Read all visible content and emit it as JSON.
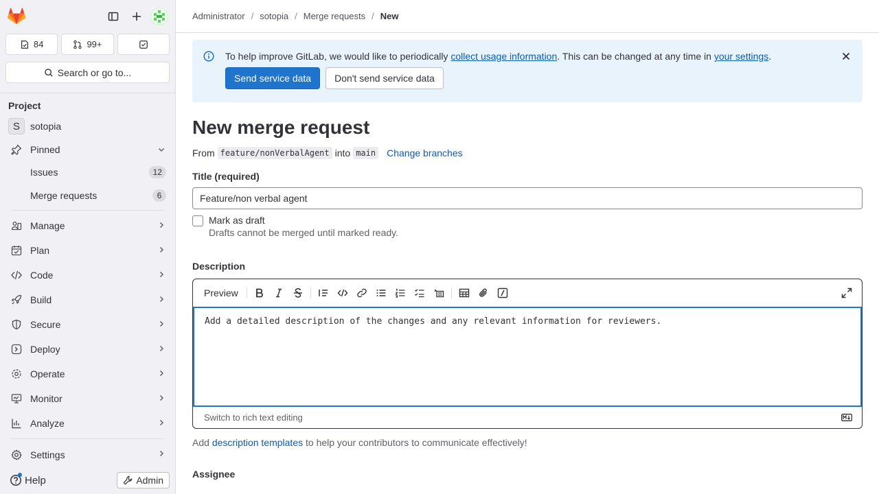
{
  "sidebar": {
    "counters": {
      "issues": "84",
      "merge_requests": "99+"
    },
    "search_label": "Search or go to...",
    "section_title": "Project",
    "project": {
      "letter": "S",
      "name": "sotopia"
    },
    "pinned": {
      "label": "Pinned",
      "items": [
        {
          "label": "Issues",
          "count": "12"
        },
        {
          "label": "Merge requests",
          "count": "6"
        }
      ]
    },
    "nav": [
      {
        "label": "Manage",
        "icon": "users-icon"
      },
      {
        "label": "Plan",
        "icon": "planning-icon"
      },
      {
        "label": "Code",
        "icon": "code-icon"
      },
      {
        "label": "Build",
        "icon": "rocket-icon"
      },
      {
        "label": "Secure",
        "icon": "shield-icon"
      },
      {
        "label": "Deploy",
        "icon": "deployments-icon"
      },
      {
        "label": "Operate",
        "icon": "cloud-gear-icon"
      },
      {
        "label": "Monitor",
        "icon": "monitor-icon"
      },
      {
        "label": "Analyze",
        "icon": "chart-icon"
      }
    ],
    "settings_label": "Settings",
    "help_label": "Help",
    "admin_label": "Admin"
  },
  "breadcrumb": {
    "items": [
      "Administrator",
      "sotopia",
      "Merge requests"
    ],
    "current": "New"
  },
  "alert": {
    "text_before": "To help improve GitLab, we would like to periodically ",
    "link1": "collect usage information",
    "text_middle": ". This can be changed at any time in ",
    "link2": "your settings",
    "text_after": ".",
    "primary_button": "Send service data",
    "secondary_button": "Don't send service data"
  },
  "page": {
    "title": "New merge request",
    "from_label": "From",
    "source_branch": "feature/nonVerbalAgent",
    "into_label": "into",
    "target_branch": "main",
    "change_branches": "Change branches"
  },
  "form": {
    "title_label": "Title (required)",
    "title_value": "Feature/non verbal agent",
    "draft_label": "Mark as draft",
    "draft_help": "Drafts cannot be merged until marked ready.",
    "description_label": "Description",
    "preview_label": "Preview",
    "description_placeholder": "Add a detailed description of the changes and any relevant information for reviewers.",
    "rich_text_switch": "Switch to rich text editing",
    "templates_before": "Add ",
    "templates_link": "description templates",
    "templates_after": " to help your contributors to communicate effectively!",
    "assignee_label": "Assignee"
  },
  "colors": {
    "accent": "#1f75cb",
    "alert_bg": "#e9f3fc",
    "sidebar_bg": "#f1f0f5",
    "logo": "#e24329"
  }
}
